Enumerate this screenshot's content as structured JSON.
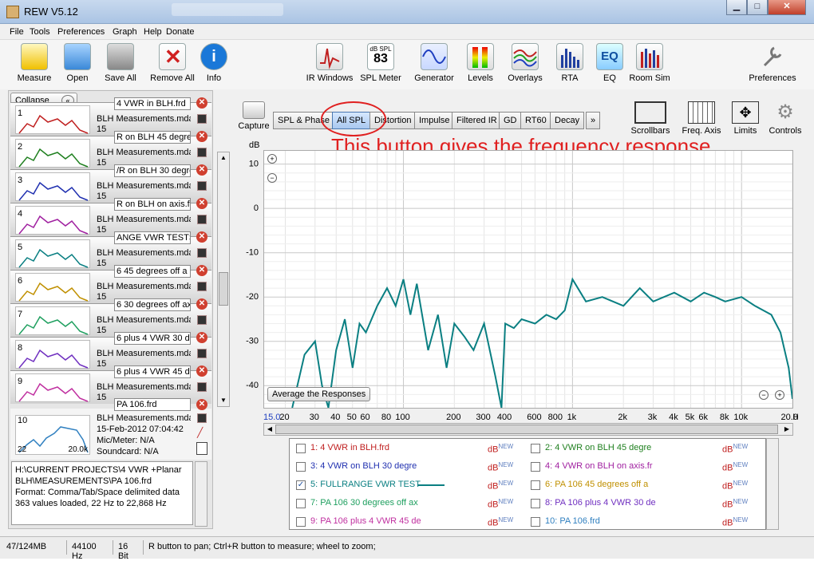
{
  "window": {
    "title": "REW V5.12"
  },
  "menu": [
    "File",
    "Tools",
    "Preferences",
    "Graph",
    "Help",
    "Donate"
  ],
  "toolbar_left": [
    "Measure",
    "Open",
    "Save All",
    "Remove All",
    "Info"
  ],
  "toolbar_mid": [
    "IR Windows",
    "SPL Meter",
    "Generator",
    "Levels",
    "Overlays",
    "RTA",
    "EQ",
    "Room Sim"
  ],
  "spl_meter": {
    "top": "dB SPL",
    "value": "83"
  },
  "toolbar_right": "Preferences",
  "collapse_label": "Collapse",
  "measurements": [
    {
      "num": "1",
      "name": "4 VWR in BLH.frd",
      "sub": "BLH Measurements.mdat",
      "sub2": "15"
    },
    {
      "num": "2",
      "name": "R on BLH  45 degre",
      "sub": "BLH Measurements.mdat",
      "sub2": "15"
    },
    {
      "num": "3",
      "name": "/R on BLH 30 degre",
      "sub": "BLH Measurements.mdat",
      "sub2": "15"
    },
    {
      "num": "4",
      "name": "R on BLH on axis.fr",
      "sub": "BLH Measurements.mdat",
      "sub2": "15"
    },
    {
      "num": "5",
      "name": "ANGE VWR TESTS .",
      "sub": "BLH Measurements.mdat",
      "sub2": "15"
    },
    {
      "num": "6",
      "name": "6  45 degrees off a",
      "sub": "BLH Measurements.mdat",
      "sub2": "15"
    },
    {
      "num": "7",
      "name": "6 30 degrees off ax",
      "sub": "BLH Measurements.mdat",
      "sub2": "15"
    },
    {
      "num": "8",
      "name": "6 plus 4 VWR 30 de",
      "sub": "BLH Measurements.mdat",
      "sub2": "15"
    },
    {
      "num": "9",
      "name": "6 plus 4 VWR 45 de",
      "sub": "BLH Measurements.mdat",
      "sub2": "15"
    }
  ],
  "selected_measurement": {
    "num": "10",
    "name": "PA 106.frd",
    "file": "BLH Measurements.mdat",
    "date": "15-Feb-2012 07:04:42",
    "mic": "Mic/Meter: N/A",
    "soundcard": "Soundcard: N/A",
    "thumb_left": "22",
    "thumb_right": "20.0k"
  },
  "info_lines": [
    "H:\\CURRENT PROJECTS\\4 VWR +Planar",
    "BLH\\MEASUREMENTS\\PA 106.frd",
    "Format: Comma/Tab/Space delimited data",
    "363 values loaded, 22 Hz to 22,868 Hz"
  ],
  "capture_label": "Capture",
  "graph_tabs": [
    "SPL & Phase",
    "All SPL",
    "Distortion",
    "Impulse",
    "Filtered IR",
    "GD",
    "RT60",
    "Decay",
    "»"
  ],
  "graph_right_buttons": [
    "Scrollbars",
    "Freq. Axis",
    "Limits",
    "Controls"
  ],
  "annotation": "This button gives the frequency response",
  "colors": {
    "trace": "#0a7f82",
    "annotation": "#e02020"
  },
  "chart_data": {
    "type": "line",
    "ylabel": "dB",
    "ylim": [
      -45,
      13
    ],
    "xlim_hz": [
      15,
      20000
    ],
    "x_scale": "log",
    "yticks": [
      "10",
      "0",
      "-10",
      "-20",
      "-30",
      "-40"
    ],
    "xticks": [
      "15.0",
      "20",
      "30",
      "40",
      "50",
      "60",
      "80",
      "100",
      "200",
      "300",
      "400",
      "600",
      "800",
      "1k",
      "2k",
      "3k",
      "4k",
      "5k",
      "6k",
      "8k",
      "10k",
      "20.0k",
      "Hz"
    ],
    "series": [
      {
        "name": "5: FULLRANGE VWR TEST",
        "x": [
          22,
          26,
          30,
          33,
          36,
          40,
          45,
          50,
          55,
          60,
          70,
          80,
          90,
          100,
          110,
          120,
          140,
          160,
          180,
          200,
          230,
          260,
          300,
          350,
          380,
          400,
          450,
          500,
          600,
          700,
          800,
          900,
          1000,
          1200,
          1500,
          2000,
          2500,
          3000,
          4000,
          5000,
          6000,
          7000,
          8000,
          10000,
          12000,
          15000,
          17000,
          19000,
          20000
        ],
        "y": [
          -45,
          -33,
          -30,
          -40,
          -45,
          -32,
          -25,
          -36,
          -26,
          -28,
          -22,
          -18,
          -22,
          -16,
          -24,
          -17,
          -32,
          -24,
          -36,
          -26,
          -29,
          -32,
          -26,
          -38,
          -45,
          -26,
          -27,
          -25,
          -26,
          -24,
          -25,
          -23,
          -16,
          -21,
          -20,
          -22,
          -18,
          -21,
          -19,
          -21,
          -19,
          -20,
          -21,
          -20,
          -22,
          -24,
          -28,
          -36,
          -43
        ]
      }
    ],
    "average_button": "Average the Responses"
  },
  "legend_items": [
    {
      "label": "1: 4 VWR in BLH.frd",
      "color": "#c02020",
      "checked": false,
      "unit": "dB"
    },
    {
      "label": "2: 4 VWR on BLH  45 degre",
      "color": "#208020",
      "checked": false,
      "unit": "dB"
    },
    {
      "label": "3: 4 VWR on BLH 30 degre",
      "color": "#2030b0",
      "checked": false,
      "unit": "dB"
    },
    {
      "label": "4: 4 VWR on BLH on axis.fr",
      "color": "#a020a0",
      "checked": false,
      "unit": "dB"
    },
    {
      "label": "5: FULLRANGE VWR TEST",
      "color": "#0a7f82",
      "checked": true,
      "unit": "dB"
    },
    {
      "label": "6: PA 106  45 degrees off a",
      "color": "#c09000",
      "checked": false,
      "unit": "dB"
    },
    {
      "label": "7: PA 106 30 degrees off ax",
      "color": "#20a060",
      "checked": false,
      "unit": "dB"
    },
    {
      "label": "8: PA 106 plus 4 VWR 30 de",
      "color": "#7030c0",
      "checked": false,
      "unit": "dB"
    },
    {
      "label": "9: PA 106 plus 4 VWR 45 de",
      "color": "#c030a0",
      "checked": false,
      "unit": "dB"
    },
    {
      "label": "10: PA 106.frd",
      "color": "#3080c0",
      "checked": false,
      "unit": "dB"
    }
  ],
  "legend_unit_sup": "NEW",
  "status": [
    "47/124MB",
    "44100 Hz",
    "16 Bit",
    "R button to pan; Ctrl+R button to measure; wheel to zoom;"
  ]
}
